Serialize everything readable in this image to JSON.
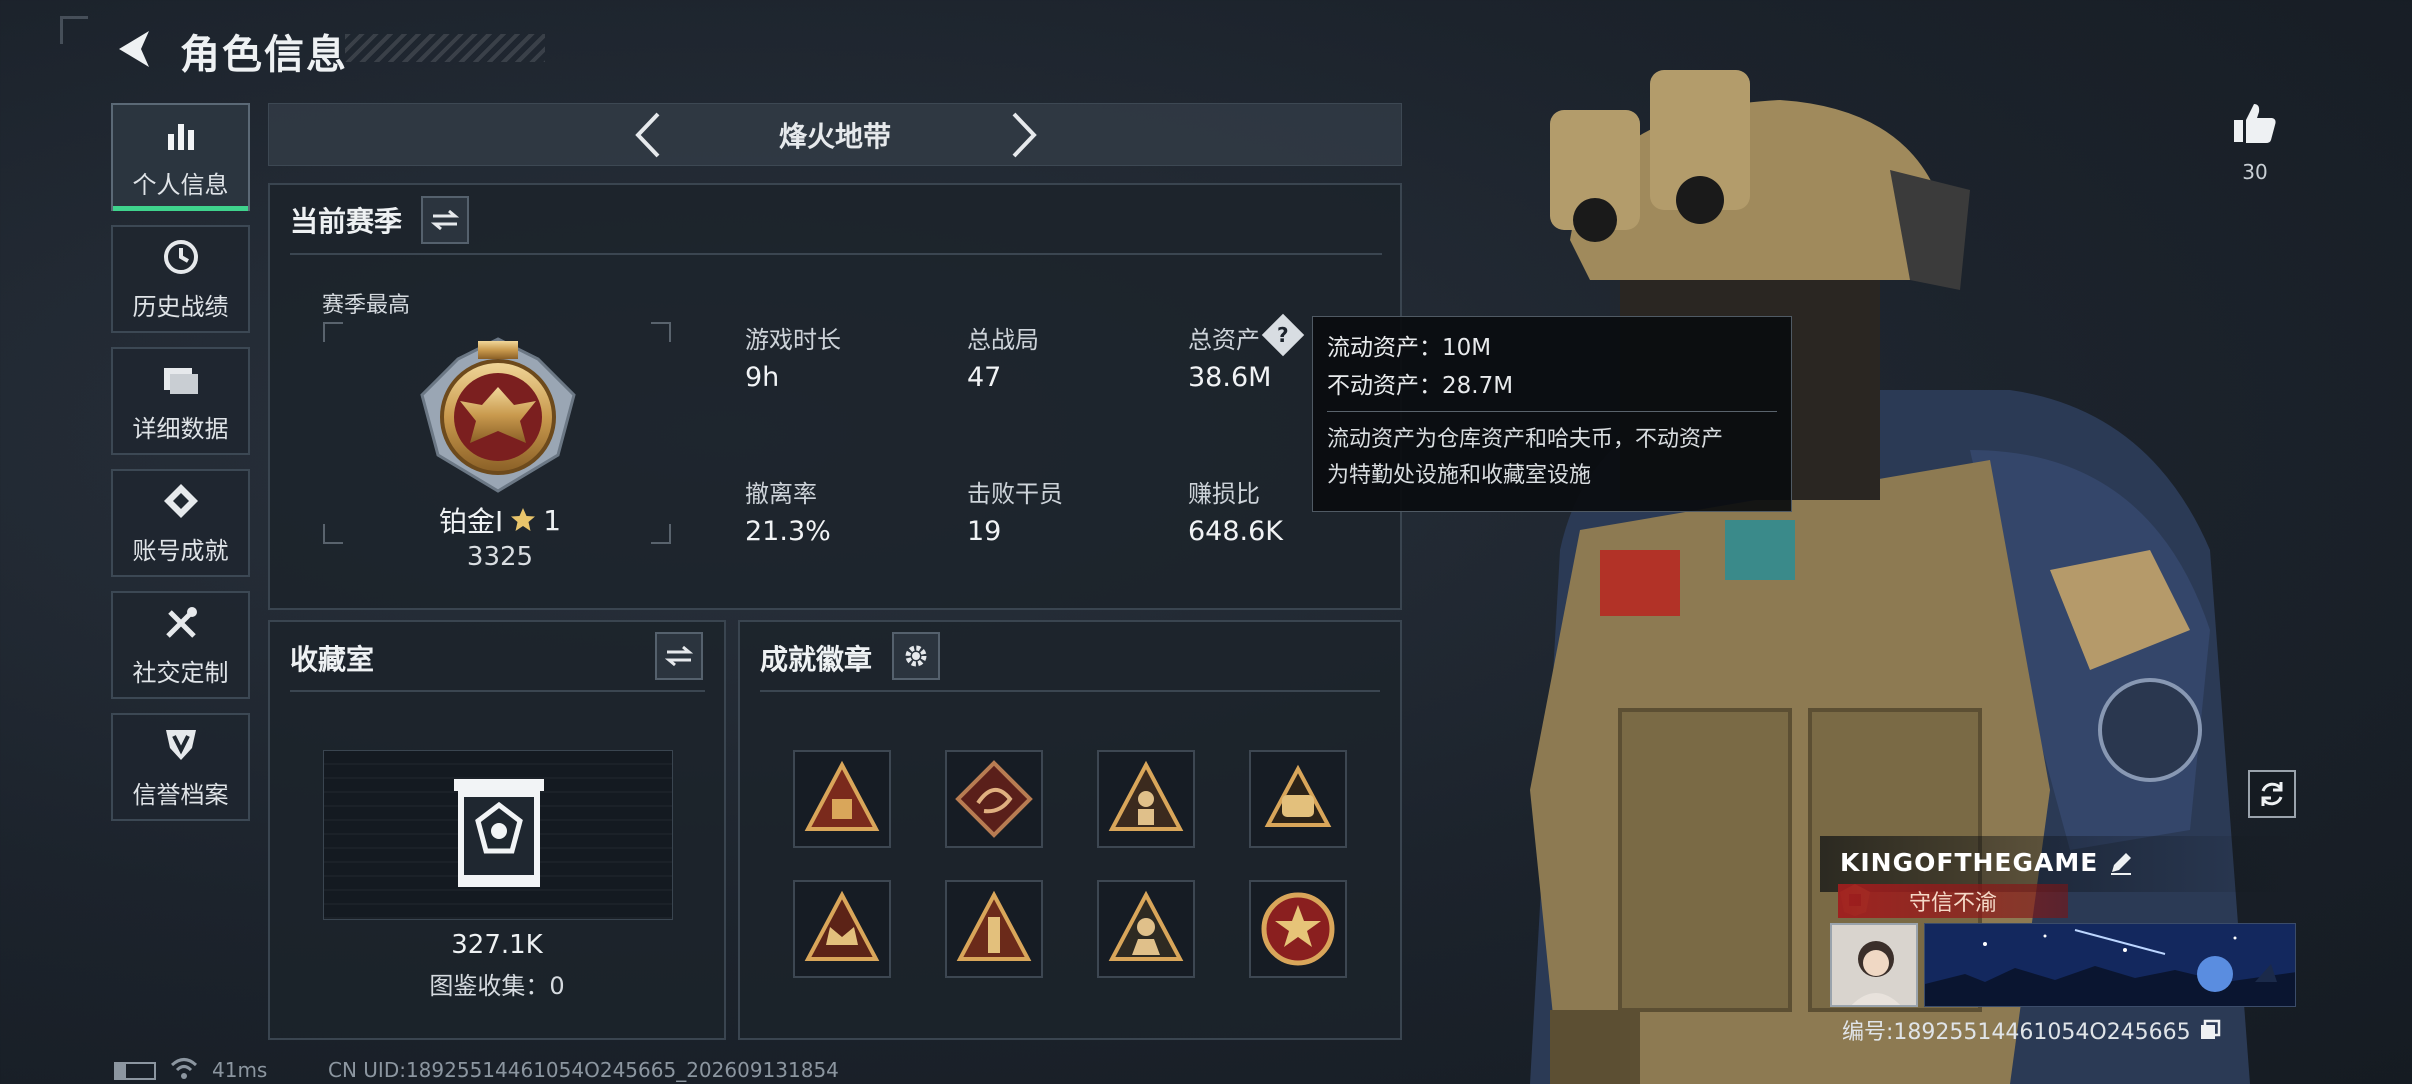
{
  "header": {
    "title": "角色信息"
  },
  "nav": {
    "items": [
      {
        "label": "个人信息",
        "icon": "bar-chart-icon",
        "active": true
      },
      {
        "label": "历史战绩",
        "icon": "history-icon"
      },
      {
        "label": "详细数据",
        "icon": "folder-icon"
      },
      {
        "label": "账号成就",
        "icon": "achievement-icon"
      },
      {
        "label": "社交定制",
        "icon": "tools-icon"
      },
      {
        "label": "信誉档案",
        "icon": "credit-icon"
      }
    ]
  },
  "mode": {
    "title": "烽火地带"
  },
  "season": {
    "title": "当前赛季",
    "best_label": "赛季最高",
    "rank_name": "铂金I",
    "rank_star": "1",
    "rank_score": "3325",
    "stats": [
      {
        "label": "游戏时长",
        "value": "9h"
      },
      {
        "label": "总战局",
        "value": "47"
      },
      {
        "label": "总资产",
        "value": "38.6M"
      },
      {
        "label": "撤离率",
        "value": "21.3%"
      },
      {
        "label": "击败干员",
        "value": "19"
      },
      {
        "label": "赚损比",
        "value": "648.6K"
      }
    ]
  },
  "tooltip": {
    "line1": "流动资产：10M",
    "line2": "不动资产：28.7M",
    "desc1": "流动资产为仓库资产和哈夫币，不动资产",
    "desc2": "为特勤处设施和收藏室设施"
  },
  "collection": {
    "title": "收藏室",
    "value": "327.1K",
    "codex_text": "图鉴收集：0"
  },
  "badges": {
    "title": "成就徽章",
    "items": [
      "badge-1",
      "badge-2",
      "badge-3",
      "badge-4",
      "badge-5",
      "badge-6",
      "badge-7",
      "badge-8"
    ]
  },
  "profile": {
    "likes": "30",
    "player_name": "KINGOFTHEGAME",
    "title_badge": "守信不渝",
    "id_text": "编号:18925514461054O245665"
  },
  "status_bar": {
    "ping": "41ms",
    "uid": "CN UID:18925514461054O245665_202609131854"
  },
  "colors": {
    "accent": "#3fd38d",
    "tooltip_bg": "#0a0c0f",
    "title_red": "#a01e1e"
  }
}
